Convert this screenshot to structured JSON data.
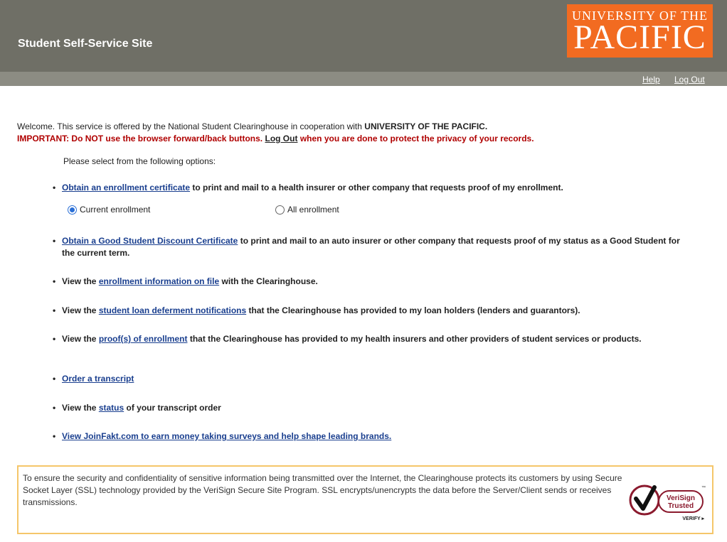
{
  "header": {
    "site_title": "Student Self-Service Site",
    "logo_line1": "UNIVERSITY OF THE",
    "logo_line2": "PACIFIC",
    "help_link": "Help",
    "logout_link": "Log Out"
  },
  "welcome": {
    "text_prefix": "Welcome. This service is offered by the National Student Clearinghouse in cooperation with ",
    "school": "UNIVERSITY OF THE PACIFIC."
  },
  "important": {
    "prefix": "IMPORTANT: Do NOT use the browser forward/back buttons.",
    "logout": "Log Out",
    "suffix": "when you are done to protect the privacy of your records."
  },
  "please_select": "Please select from the following options:",
  "options": {
    "enroll_cert": {
      "link": "Obtain an enrollment certificate",
      "text": "to print and mail to a health insurer or other company that requests proof of my enrollment."
    },
    "radio_current": "Current enrollment",
    "radio_all": "All enrollment",
    "good_student": {
      "link": "Obtain a Good Student Discount Certificate",
      "text": "to print and mail to an auto insurer or other company that requests proof of my status as a Good Student for the current term."
    },
    "enroll_info": {
      "pre": "View the",
      "link": "enrollment information on file",
      "text": "with the Clearinghouse."
    },
    "loan_defer": {
      "pre": "View the",
      "link": "student loan deferment notifications",
      "text": "that the Clearinghouse has provided to my loan holders (lenders and guarantors)."
    },
    "proof": {
      "pre": "View the",
      "link": "proof(s) of enrollment",
      "text": "that the Clearinghouse has provided to my health insurers and other providers of student services or products."
    },
    "transcript": {
      "link": "Order a transcript"
    },
    "status": {
      "pre": "View the",
      "link": "status",
      "text": "of your transcript order"
    },
    "joinfakt": {
      "link": "View JoinFakt.com to earn money taking surveys and help shape leading brands."
    }
  },
  "security": {
    "text": "To ensure the security and confidentiality of sensitive information being transmitted over the Internet, the Clearinghouse protects its customers by using Secure Socket Layer (SSL) technology provided by the VeriSign Secure Site Program. SSL encrypts/unencrypts the data before the Server/Client sends or receives transmissions.",
    "badge_line1": "VeriSign",
    "badge_line2": "Trusted",
    "badge_verify": "VERIFY ▸",
    "badge_tm": "™"
  },
  "colors": {
    "header_bg": "#6f6f66",
    "logo_bg": "#f26b21",
    "link": "#1a3f8f",
    "important": "#b00000",
    "security_border": "#f5c66a"
  }
}
